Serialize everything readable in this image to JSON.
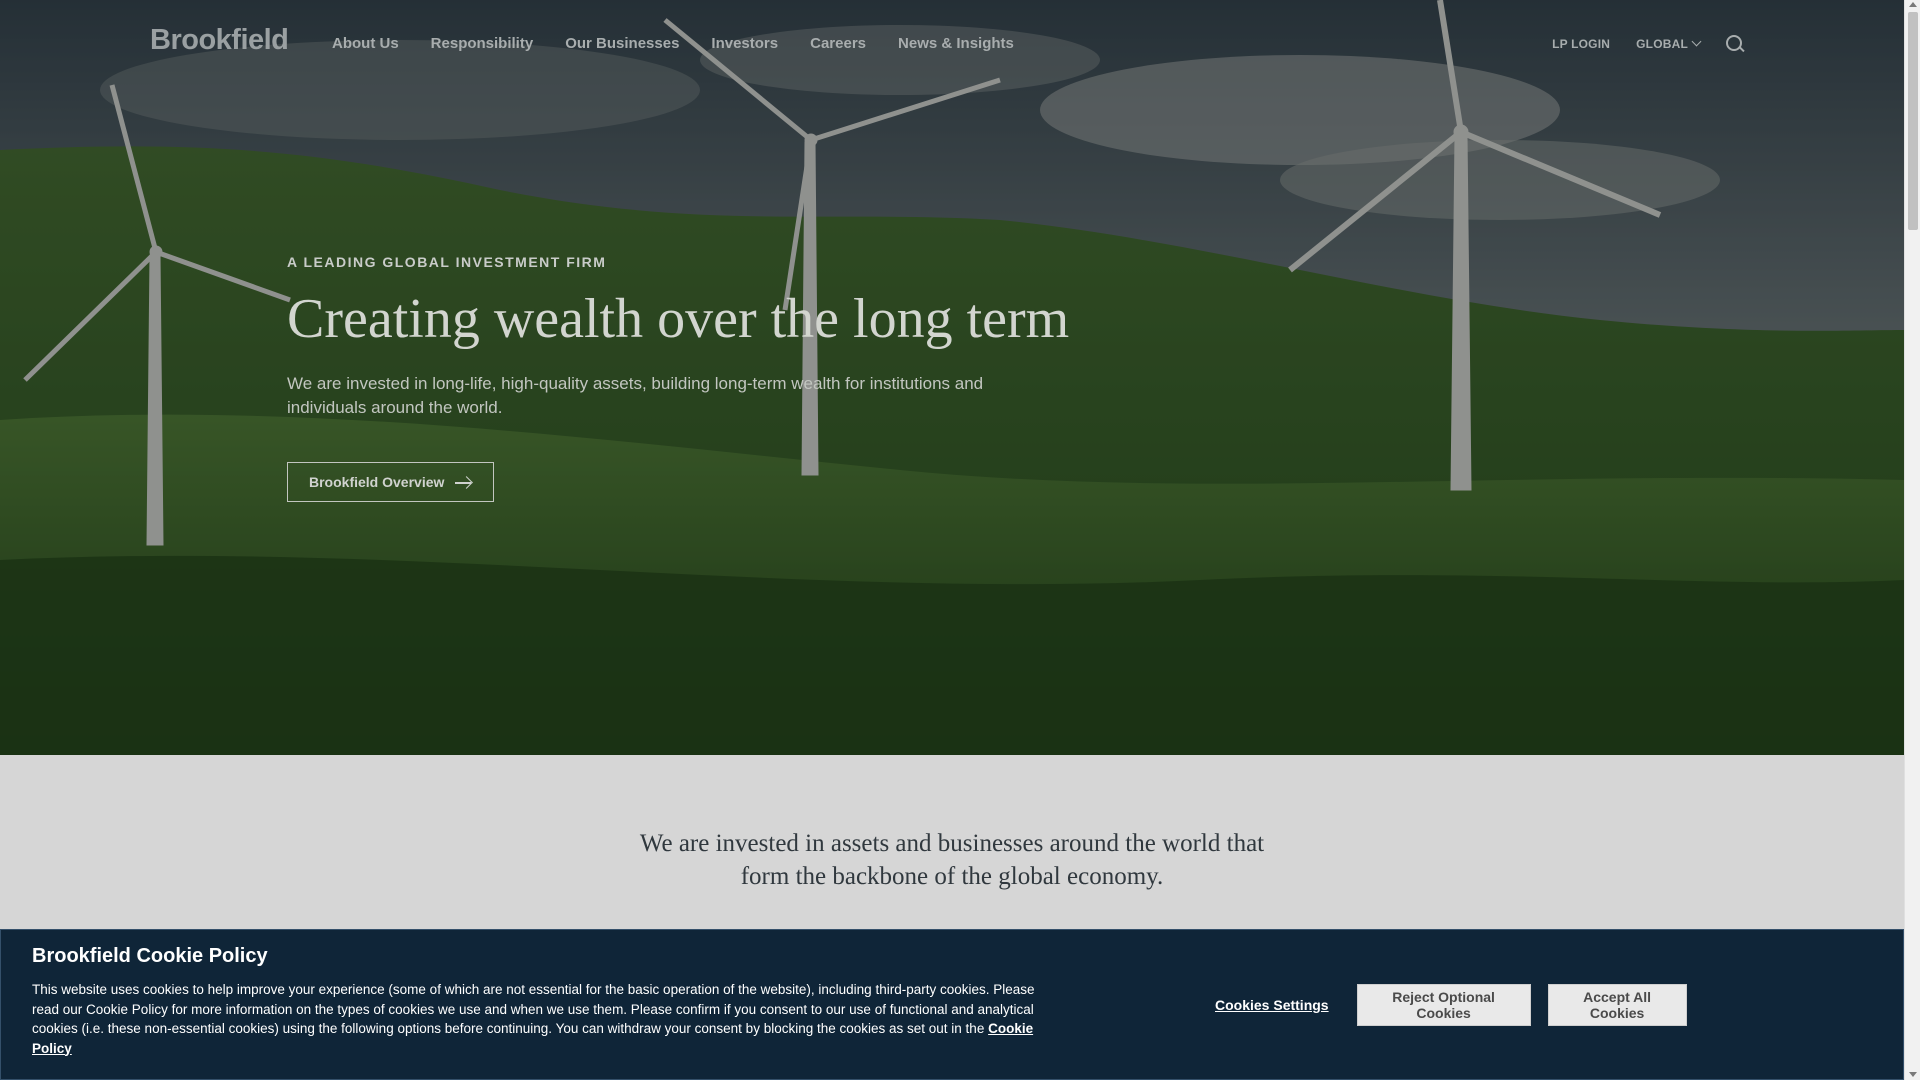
{
  "brand": {
    "logo_text": "Brookfield"
  },
  "nav": {
    "links": [
      "About Us",
      "Responsibility",
      "Our Businesses",
      "Investors",
      "Careers",
      "News & Insights"
    ],
    "lp_login": "LP LOGIN",
    "region": "GLOBAL",
    "search_icon": "search-icon"
  },
  "hero": {
    "eyebrow": "A LEADING GLOBAL INVESTMENT FIRM",
    "title": "Creating wealth over the long term",
    "description": "We are invested in long-life, high-quality assets, building long-term wealth for institutions and individuals around the world.",
    "cta_label": "Brookfield Overview",
    "cta_icon": "arrow-right-icon"
  },
  "intro": {
    "line1": "We are invested in assets and businesses around the world that",
    "line2": "form the backbone of the global economy."
  },
  "cookie_banner": {
    "title": "Brookfield Cookie Policy",
    "body": "This website uses cookies to help improve your experience (some of which are not essential for the basic operation of the website), including third-party cookies. Please read our Cookie Policy for more information on the types of cookies we use and when we use them. Please confirm if you consent to our use of functional and analytical cookies (i.e. these non-essential cookies) using the following options before continuing. You can withdraw your consent by blocking the cookies as set out in the",
    "policy_link": "Cookie Policy",
    "settings_label": "Cookies Settings",
    "reject_label": "Reject Optional Cookies",
    "accept_label": "Accept All Cookies",
    "background_color": "#0f2538"
  }
}
